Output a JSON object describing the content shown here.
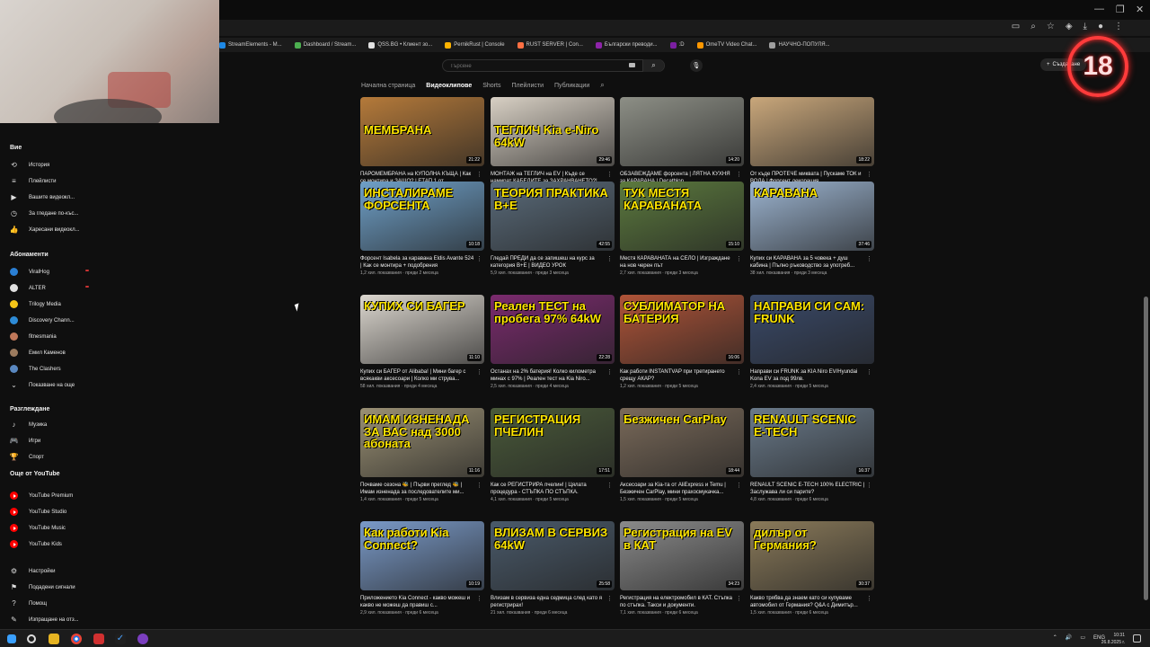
{
  "bookmarks": [
    {
      "label": "StreamElements - M...",
      "color": "#1e88e5"
    },
    {
      "label": "Dashboard / Stream...",
      "color": "#4caf50"
    },
    {
      "label": "QSS.BG • Клиент зо...",
      "color": "#e0e0e0"
    },
    {
      "label": "PernikRust | Console",
      "color": "#ffb300"
    },
    {
      "label": "RUST SERVER | Con...",
      "color": "#ff7043"
    },
    {
      "label": "Български преводи...",
      "color": "#8e24aa"
    },
    {
      "label": ":D",
      "color": "#7b1fa2"
    },
    {
      "label": "OmeTV Video Chat...",
      "color": "#ff9800"
    },
    {
      "label": "НАУЧНО-ПОПУЛЯ...",
      "color": "#9e9e9e"
    }
  ],
  "header": {
    "search_placeholder": "Търсене",
    "create_label": "Създаване",
    "badge": "18"
  },
  "channel_tabs": [
    "Начална страница",
    "Видеоклипове",
    "Shorts",
    "Плейлисти",
    "Публикации"
  ],
  "sidebar": {
    "you_heading": "Вие",
    "you_items": [
      "История",
      "Плейлисти",
      "Вашите видеокл...",
      "За гледане по-къс...",
      "Харесани видеокл..."
    ],
    "subs_heading": "Абонаменти",
    "subs": [
      {
        "label": "ViralHog",
        "color": "#2a7fd4"
      },
      {
        "label": "ALTER",
        "color": "#e0e0e0"
      },
      {
        "label": "Trilogy Media",
        "color": "#f5c518"
      },
      {
        "label": "Discovery Chann...",
        "color": "#2d8bd6"
      },
      {
        "label": "fitnesmania",
        "color": "#c0785a"
      },
      {
        "label": "Емил Каменов",
        "color": "#9c7b5e"
      },
      {
        "label": "The Clashers",
        "color": "#5a88c0"
      }
    ],
    "show_more": "Показване на още",
    "browse_heading": "Разглеждане",
    "browse_items": [
      "Музика",
      "Игри",
      "Спорт"
    ],
    "more_heading": "Още от YouTube",
    "more_items": [
      "YouTube Premium",
      "YouTube Studio",
      "YouTube Music",
      "YouTube Kids"
    ],
    "settings_items": [
      "Настройки",
      "Подадени сигнали",
      "Помощ",
      "Изпращане на отз..."
    ]
  },
  "videos": [
    {
      "thumb": "МЕМБРАНА",
      "bg": "#b57a3a",
      "dur": "21:22",
      "title": "ПАРОМЕМБРАНА на КУПОЛНА КЪЩА | Как се монтира и ЗАЩО? | ЕТАП 1 от ...",
      "meta": "1,7 хил. показвания · преди 1 месец"
    },
    {
      "thumb": "ТЕГЛИЧ Kia e-Niro 64kW",
      "bg": "#d8d0c4",
      "dur": "29:46",
      "title": "МОНТАЖ на ТЕГЛИЧ на EV | Къде се намират КАБЕЛИТЕ за ЗАХРАНВАНЕТО?!...",
      "meta": "1,2 хил. показвания · преди 2 месеца"
    },
    {
      "thumb": "",
      "bg": "#8d8f86",
      "dur": "14:20",
      "title": "ОБЗАВЕЖДАМЕ форсента | ЛЯТНА КУХНЯ за КАРАВАНА | Decathlon",
      "meta": "2,2 хил. показвания · преди 2 месеца"
    },
    {
      "thumb": "",
      "bg": "#c9a77b",
      "dur": "18:22",
      "title": "От къде ПРОТЕЧЕ миквата | Пускаме ТОК и ВОДА | Форсент декорация",
      "meta": "3,3 хил. показвания · преди 2 месеца"
    },
    {
      "thumb": "ИНСТАЛИРАМЕ ФОРСЕНТА",
      "bg": "#6fa0c8",
      "dur": "10:18",
      "title": "Форсент Isabela за каравана Eldis Avante 524 | Как се монтира + подобрения",
      "meta": "1,2 хил. показвания · преди 2 месеца"
    },
    {
      "thumb": "ТЕОРИЯ ПРАКТИКА B+E",
      "bg": "#5a6b7a",
      "dur": "42:55",
      "title": "Гледай ПРЕДИ да се запишеш на курс за категория B+E | ВИДЕО УРОК",
      "meta": "5,9 хил. показвания · преди 3 месеца"
    },
    {
      "thumb": "ТУК МЕСТЯ КАРАВАНАТА",
      "bg": "#5c7a3e",
      "dur": "15:10",
      "title": "Местя КАРАВАНАТА на СЕЛО | Изграждане на нов черен път",
      "meta": "2,7 хил. показвания · преди 3 месеца"
    },
    {
      "thumb": "КАРАВАНА",
      "bg": "#9cb4d0",
      "dur": "37:46",
      "title": "Купих си КАРАВАНА за 5 човека + душ кабина | Пълно ръководство за употреб...",
      "meta": "38 хил. показвания · преди 3 месеца"
    },
    {
      "thumb": "КУПИХ СИ БАГЕР",
      "bg": "#dcd7cf",
      "dur": "11:10",
      "title": "Купих си БАГЕР от Alibaba! | Мини багер с всякакви аксесоари | Колко ми струва...",
      "meta": "58 хил. показвания · преди 4 месеца"
    },
    {
      "thumb": "Реален ТЕСТ на пробега 97% 64kW",
      "bg": "#7b2a6e",
      "dur": "22:28",
      "title": "Останах на 2% батерия! Колко километра минах с 97% | Реален тест на Kia Niro...",
      "meta": "2,5 хил. показвания · преди 4 месеца"
    },
    {
      "thumb": "СУБЛИМАТОР НА БАТЕРИЯ",
      "bg": "#b05438",
      "dur": "16:06",
      "title": "Как работи INSTANTVAP при третирането срещу АКАР?",
      "meta": "1,2 хил. показвания · преди 5 месеца"
    },
    {
      "thumb": "НАПРАВИ СИ САМ: FRUNK",
      "bg": "#3a4a6a",
      "dur": "",
      "title": "Направи си FRUNK за KIA Niro EV/Hyundai Kona EV за под 99лв.",
      "meta": "2,4 хил. показвания · преди 5 месеца"
    },
    {
      "thumb": "ИМАМ ИЗНЕНАДА ЗА ВАС над 3000 абоната",
      "bg": "#9a9074",
      "dur": "11:16",
      "title": "Почваме сезона 🐝 | Първи преглед 🐝 | Имам изненада за последователите ми...",
      "meta": "1,4 хил. показвания · преди 5 месеца"
    },
    {
      "thumb": "РЕГИСТРАЦИЯ ПЧЕЛИН",
      "bg": "#4a5a3a",
      "dur": "17:51",
      "title": "Как се РЕГИСТРИРА пчелин! | Цялата процедура - СТЪПКА ПО СТЪПКА.",
      "meta": "4,1 хил. показвания · преди 5 месеца"
    },
    {
      "thumb": "Безжичен CarPlay",
      "bg": "#7a6a5a",
      "dur": "18:44",
      "title": "Аксесоари за Kia-та от AliExpress и Temu | Безжичен CarPlay, мини прахосмукачка...",
      "meta": "1,5 хил. показвания · преди 5 месеца"
    },
    {
      "thumb": "RENAULT SCENIC E-TECH",
      "bg": "#6a7a8a",
      "dur": "16:37",
      "title": "RENAULT SCENIC E-TECH 100% ELECTRIC | Заслужава ли си парите?",
      "meta": "4,8 хил. показвания · преди 6 месеца"
    },
    {
      "thumb": "Как работи Kia Connect?",
      "bg": "#7a9ac8",
      "dur": "10:19",
      "title": "Приложението Kia Connect - какво можеш и какво не можеш да правиш с...",
      "meta": "2,9 хил. показвания · преди 6 месеца"
    },
    {
      "thumb": "ВЛИЗАМ В СЕРВИЗ 64kW",
      "bg": "#4a5a6a",
      "dur": "25:58",
      "title": "Влизам в сервиза една седмица след като я регистрирах!",
      "meta": "21 хил. показвания · преди 6 месеца"
    },
    {
      "thumb": "Регистрация на EV в КАТ",
      "bg": "#8a8a8a",
      "dur": "34:23",
      "title": "Регистрация на електромобил в КАТ. Стъпка по стъпка. Такси и документи.",
      "meta": "7,1 хил. показвания · преди 6 месеца"
    },
    {
      "thumb": "дилър от Германия?",
      "bg": "#8a7a5a",
      "dur": "30:37",
      "title": "Какво трябва да знаем като си купуваме автомобил от Германия? Q&A с Димитър...",
      "meta": "1,5 хил. показвания · преди 6 месеца"
    }
  ],
  "tray": {
    "lang": "ENG",
    "time": "10:31",
    "date": "26.8.2025 г."
  }
}
